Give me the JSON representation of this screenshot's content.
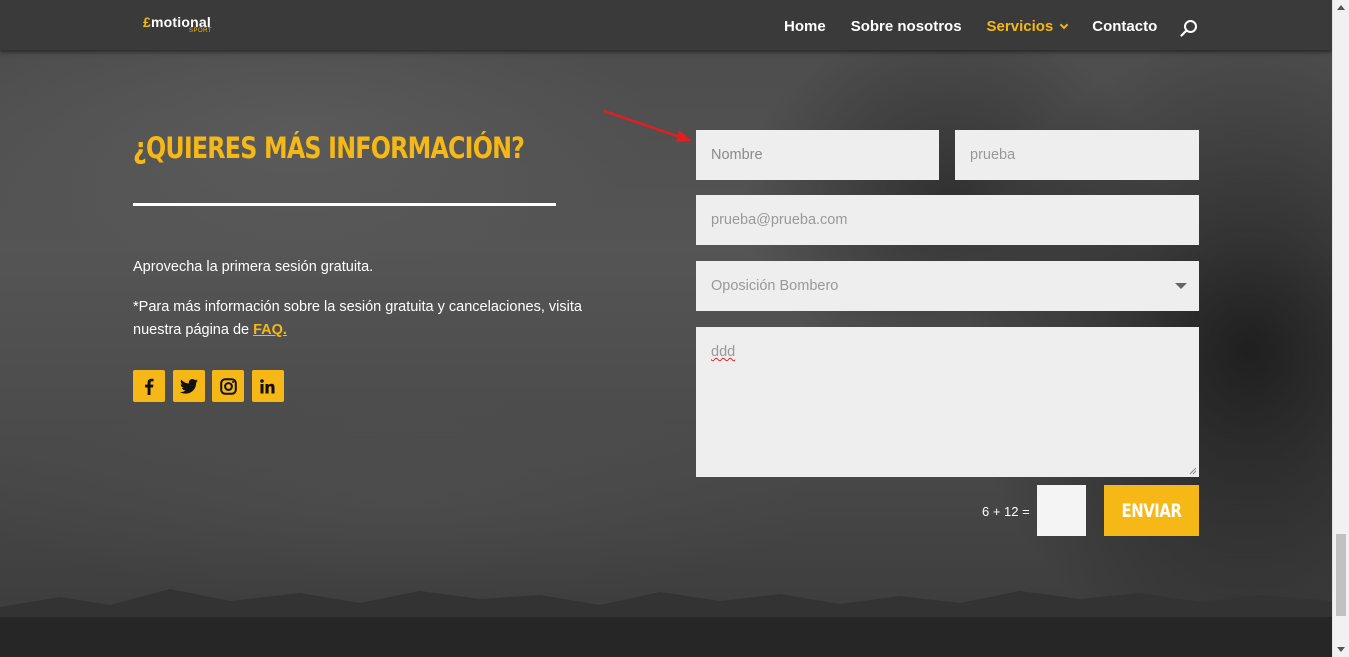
{
  "header": {
    "logo": {
      "main": "motional",
      "prefix": "£",
      "sub": "SPORT"
    },
    "nav": [
      {
        "label": "Home"
      },
      {
        "label": "Sobre nosotros"
      },
      {
        "label": "Servicios",
        "active": true
      },
      {
        "label": "Contacto"
      }
    ]
  },
  "section": {
    "title": "¿QUIERES MÁS INFORMACIÓN?",
    "text1": "Aprovecha la primera sesión gratuita.",
    "text2": "*Para más información sobre la sesión gratuita y cancelaciones, visita nuestra página de",
    "faq_link": "FAQ.",
    "socials": [
      "facebook-icon",
      "twitter-icon",
      "instagram-icon",
      "linkedin-icon"
    ]
  },
  "form": {
    "nombre_placeholder": "Nombre",
    "apellido_value": "prueba",
    "email_value": "prueba@prueba.com",
    "select_value": "Oposición Bombero",
    "message_value": "ddd",
    "captcha_label": "6 + 12 =",
    "captcha_value": "",
    "submit_label": "ENVIAR"
  },
  "colors": {
    "accent": "#f5b816",
    "header_bg": "#3a3a3a",
    "field_bg": "#eeeeee",
    "arrow": "#e02020"
  }
}
